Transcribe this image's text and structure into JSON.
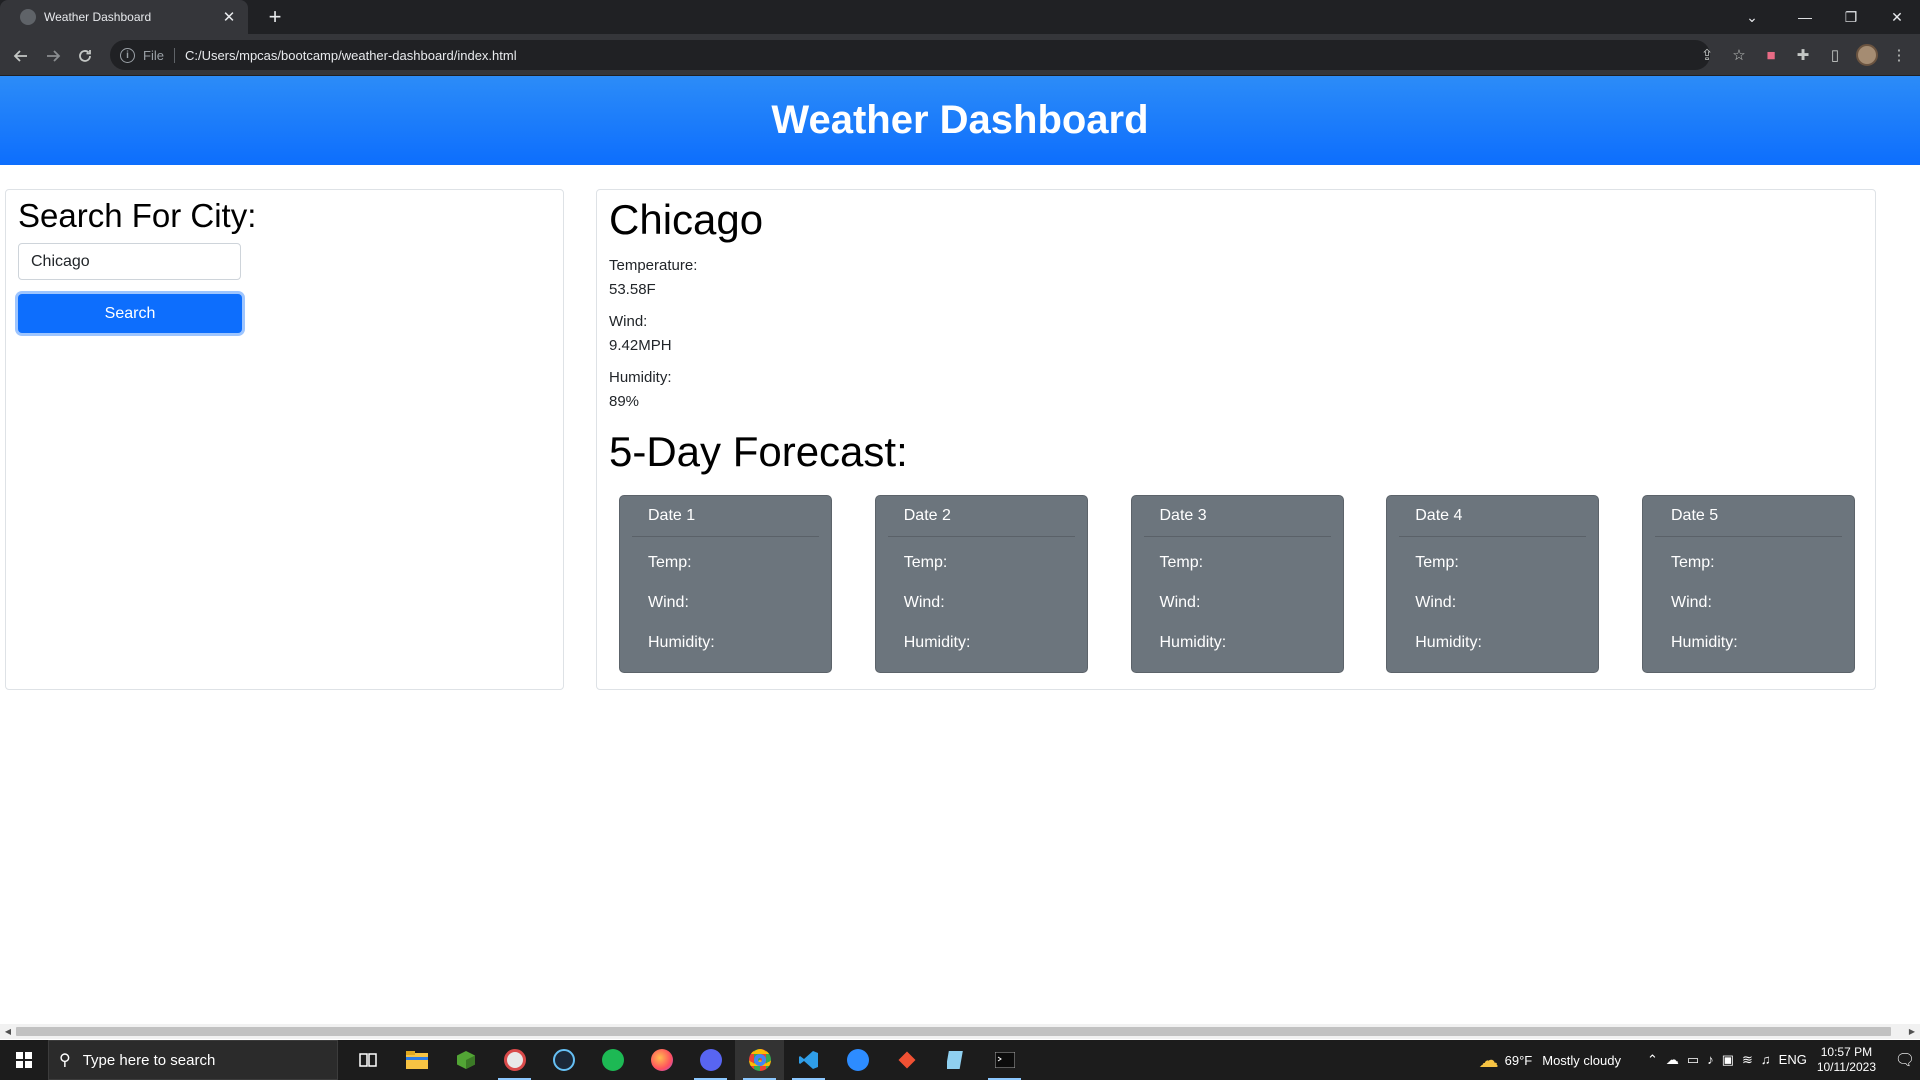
{
  "browser": {
    "tab_title": "Weather Dashboard",
    "tab_close": "✕",
    "new_tab": "+",
    "scheme_label": "File",
    "url": "C:/Users/mpcas/bootcamp/weather-dashboard/index.html",
    "window_controls": {
      "dropdown": "⌄",
      "minimize": "—",
      "restore": "❐",
      "close": "✕"
    }
  },
  "page": {
    "header_title": "Weather Dashboard",
    "search": {
      "heading": "Search For City:",
      "input_value": "Chicago",
      "button_label": "Search"
    },
    "current": {
      "city": "Chicago",
      "temperature_label": "Temperature:",
      "temperature_value": "53.58F",
      "wind_label": "Wind:",
      "wind_value": "9.42MPH",
      "humidity_label": "Humidity:",
      "humidity_value": "89%"
    },
    "forecast": {
      "title": "5-Day Forecast:",
      "cards": [
        {
          "date": "Date 1",
          "temp": "Temp:",
          "wind": "Wind:",
          "humidity": "Humidity:"
        },
        {
          "date": "Date 2",
          "temp": "Temp:",
          "wind": "Wind:",
          "humidity": "Humidity:"
        },
        {
          "date": "Date 3",
          "temp": "Temp:",
          "wind": "Wind:",
          "humidity": "Humidity:"
        },
        {
          "date": "Date 4",
          "temp": "Temp:",
          "wind": "Wind:",
          "humidity": "Humidity:"
        },
        {
          "date": "Date 5",
          "temp": "Temp:",
          "wind": "Wind:",
          "humidity": "Humidity:"
        }
      ]
    }
  },
  "taskbar": {
    "search_placeholder": "Type here to search",
    "weather_temp": "69°F",
    "weather_text": "Mostly cloudy",
    "language": "ENG",
    "time": "10:57 PM",
    "date": "10/11/2023",
    "apps": [
      "task-view",
      "file-explorer",
      "minecraft",
      "paint",
      "steam",
      "spotify",
      "firefox",
      "discord",
      "chrome",
      "vscode",
      "zoom",
      "git",
      "notepad",
      "terminal"
    ]
  },
  "colors": {
    "primary": "#0d6efd",
    "card_bg": "#6c757d",
    "chrome_dark": "#202124"
  }
}
